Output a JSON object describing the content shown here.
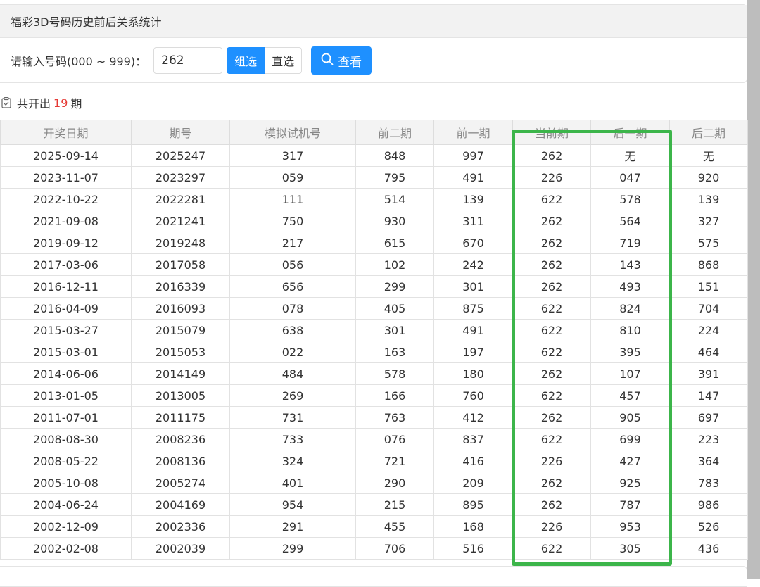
{
  "header": {
    "title": "福彩3D号码历史前后关系统计"
  },
  "form": {
    "prompt": "请输入号码(000 ~ 999)：",
    "number_value": "262",
    "option_group": "组选",
    "option_direct": "直选",
    "view_label": "查看"
  },
  "summary": {
    "prefix": "共开出",
    "count": "19",
    "suffix": "期"
  },
  "table": {
    "headers": [
      "开奖日期",
      "期号",
      "模拟试机号",
      "前二期",
      "前一期",
      "当前期",
      "后一期",
      "后二期"
    ],
    "rows": [
      [
        "2025-09-14",
        "2025247",
        "317",
        "848",
        "997",
        "262",
        "无",
        "无"
      ],
      [
        "2023-11-07",
        "2023297",
        "059",
        "795",
        "491",
        "226",
        "047",
        "920"
      ],
      [
        "2022-10-22",
        "2022281",
        "111",
        "514",
        "139",
        "622",
        "578",
        "139"
      ],
      [
        "2021-09-08",
        "2021241",
        "750",
        "930",
        "311",
        "262",
        "564",
        "327"
      ],
      [
        "2019-09-12",
        "2019248",
        "217",
        "615",
        "670",
        "262",
        "719",
        "575"
      ],
      [
        "2017-03-06",
        "2017058",
        "056",
        "102",
        "242",
        "262",
        "143",
        "868"
      ],
      [
        "2016-12-11",
        "2016339",
        "656",
        "299",
        "301",
        "262",
        "493",
        "151"
      ],
      [
        "2016-04-09",
        "2016093",
        "078",
        "405",
        "875",
        "622",
        "824",
        "704"
      ],
      [
        "2015-03-27",
        "2015079",
        "638",
        "301",
        "491",
        "622",
        "810",
        "224"
      ],
      [
        "2015-03-01",
        "2015053",
        "022",
        "163",
        "197",
        "622",
        "395",
        "464"
      ],
      [
        "2014-06-06",
        "2014149",
        "484",
        "578",
        "180",
        "262",
        "107",
        "391"
      ],
      [
        "2013-01-05",
        "2013005",
        "269",
        "166",
        "760",
        "622",
        "457",
        "147"
      ],
      [
        "2011-07-01",
        "2011175",
        "731",
        "763",
        "412",
        "262",
        "905",
        "697"
      ],
      [
        "2008-08-30",
        "2008236",
        "733",
        "076",
        "837",
        "622",
        "699",
        "223"
      ],
      [
        "2008-05-22",
        "2008136",
        "324",
        "721",
        "416",
        "226",
        "427",
        "364"
      ],
      [
        "2005-10-08",
        "2005274",
        "401",
        "290",
        "209",
        "262",
        "925",
        "783"
      ],
      [
        "2004-06-24",
        "2004169",
        "954",
        "215",
        "895",
        "262",
        "787",
        "986"
      ],
      [
        "2002-12-09",
        "2002336",
        "291",
        "455",
        "168",
        "226",
        "953",
        "526"
      ],
      [
        "2002-02-08",
        "2002039",
        "299",
        "706",
        "516",
        "622",
        "305",
        "436"
      ]
    ]
  },
  "colors": {
    "accent": "#1e90ff",
    "count": "#e53935",
    "highlight": "#3cb54a"
  },
  "icons": {
    "search": "search-icon",
    "checklist": "clipboard-check-icon"
  }
}
